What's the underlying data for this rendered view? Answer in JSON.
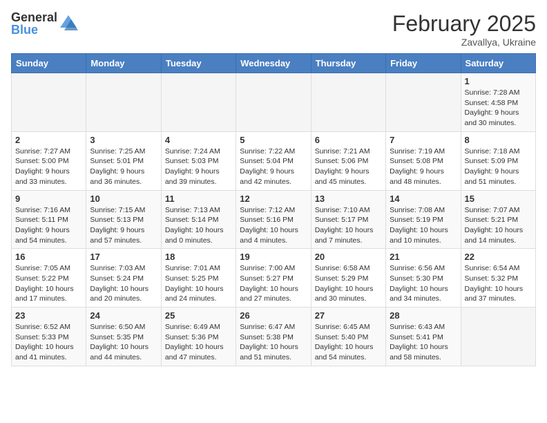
{
  "header": {
    "logo_general": "General",
    "logo_blue": "Blue",
    "month_title": "February 2025",
    "location": "Zavallya, Ukraine"
  },
  "days_of_week": [
    "Sunday",
    "Monday",
    "Tuesday",
    "Wednesday",
    "Thursday",
    "Friday",
    "Saturday"
  ],
  "weeks": [
    [
      {
        "day": "",
        "info": ""
      },
      {
        "day": "",
        "info": ""
      },
      {
        "day": "",
        "info": ""
      },
      {
        "day": "",
        "info": ""
      },
      {
        "day": "",
        "info": ""
      },
      {
        "day": "",
        "info": ""
      },
      {
        "day": "1",
        "info": "Sunrise: 7:28 AM\nSunset: 4:58 PM\nDaylight: 9 hours\nand 30 minutes."
      }
    ],
    [
      {
        "day": "2",
        "info": "Sunrise: 7:27 AM\nSunset: 5:00 PM\nDaylight: 9 hours\nand 33 minutes."
      },
      {
        "day": "3",
        "info": "Sunrise: 7:25 AM\nSunset: 5:01 PM\nDaylight: 9 hours\nand 36 minutes."
      },
      {
        "day": "4",
        "info": "Sunrise: 7:24 AM\nSunset: 5:03 PM\nDaylight: 9 hours\nand 39 minutes."
      },
      {
        "day": "5",
        "info": "Sunrise: 7:22 AM\nSunset: 5:04 PM\nDaylight: 9 hours\nand 42 minutes."
      },
      {
        "day": "6",
        "info": "Sunrise: 7:21 AM\nSunset: 5:06 PM\nDaylight: 9 hours\nand 45 minutes."
      },
      {
        "day": "7",
        "info": "Sunrise: 7:19 AM\nSunset: 5:08 PM\nDaylight: 9 hours\nand 48 minutes."
      },
      {
        "day": "8",
        "info": "Sunrise: 7:18 AM\nSunset: 5:09 PM\nDaylight: 9 hours\nand 51 minutes."
      }
    ],
    [
      {
        "day": "9",
        "info": "Sunrise: 7:16 AM\nSunset: 5:11 PM\nDaylight: 9 hours\nand 54 minutes."
      },
      {
        "day": "10",
        "info": "Sunrise: 7:15 AM\nSunset: 5:13 PM\nDaylight: 9 hours\nand 57 minutes."
      },
      {
        "day": "11",
        "info": "Sunrise: 7:13 AM\nSunset: 5:14 PM\nDaylight: 10 hours\nand 0 minutes."
      },
      {
        "day": "12",
        "info": "Sunrise: 7:12 AM\nSunset: 5:16 PM\nDaylight: 10 hours\nand 4 minutes."
      },
      {
        "day": "13",
        "info": "Sunrise: 7:10 AM\nSunset: 5:17 PM\nDaylight: 10 hours\nand 7 minutes."
      },
      {
        "day": "14",
        "info": "Sunrise: 7:08 AM\nSunset: 5:19 PM\nDaylight: 10 hours\nand 10 minutes."
      },
      {
        "day": "15",
        "info": "Sunrise: 7:07 AM\nSunset: 5:21 PM\nDaylight: 10 hours\nand 14 minutes."
      }
    ],
    [
      {
        "day": "16",
        "info": "Sunrise: 7:05 AM\nSunset: 5:22 PM\nDaylight: 10 hours\nand 17 minutes."
      },
      {
        "day": "17",
        "info": "Sunrise: 7:03 AM\nSunset: 5:24 PM\nDaylight: 10 hours\nand 20 minutes."
      },
      {
        "day": "18",
        "info": "Sunrise: 7:01 AM\nSunset: 5:25 PM\nDaylight: 10 hours\nand 24 minutes."
      },
      {
        "day": "19",
        "info": "Sunrise: 7:00 AM\nSunset: 5:27 PM\nDaylight: 10 hours\nand 27 minutes."
      },
      {
        "day": "20",
        "info": "Sunrise: 6:58 AM\nSunset: 5:29 PM\nDaylight: 10 hours\nand 30 minutes."
      },
      {
        "day": "21",
        "info": "Sunrise: 6:56 AM\nSunset: 5:30 PM\nDaylight: 10 hours\nand 34 minutes."
      },
      {
        "day": "22",
        "info": "Sunrise: 6:54 AM\nSunset: 5:32 PM\nDaylight: 10 hours\nand 37 minutes."
      }
    ],
    [
      {
        "day": "23",
        "info": "Sunrise: 6:52 AM\nSunset: 5:33 PM\nDaylight: 10 hours\nand 41 minutes."
      },
      {
        "day": "24",
        "info": "Sunrise: 6:50 AM\nSunset: 5:35 PM\nDaylight: 10 hours\nand 44 minutes."
      },
      {
        "day": "25",
        "info": "Sunrise: 6:49 AM\nSunset: 5:36 PM\nDaylight: 10 hours\nand 47 minutes."
      },
      {
        "day": "26",
        "info": "Sunrise: 6:47 AM\nSunset: 5:38 PM\nDaylight: 10 hours\nand 51 minutes."
      },
      {
        "day": "27",
        "info": "Sunrise: 6:45 AM\nSunset: 5:40 PM\nDaylight: 10 hours\nand 54 minutes."
      },
      {
        "day": "28",
        "info": "Sunrise: 6:43 AM\nSunset: 5:41 PM\nDaylight: 10 hours\nand 58 minutes."
      },
      {
        "day": "",
        "info": ""
      }
    ]
  ]
}
